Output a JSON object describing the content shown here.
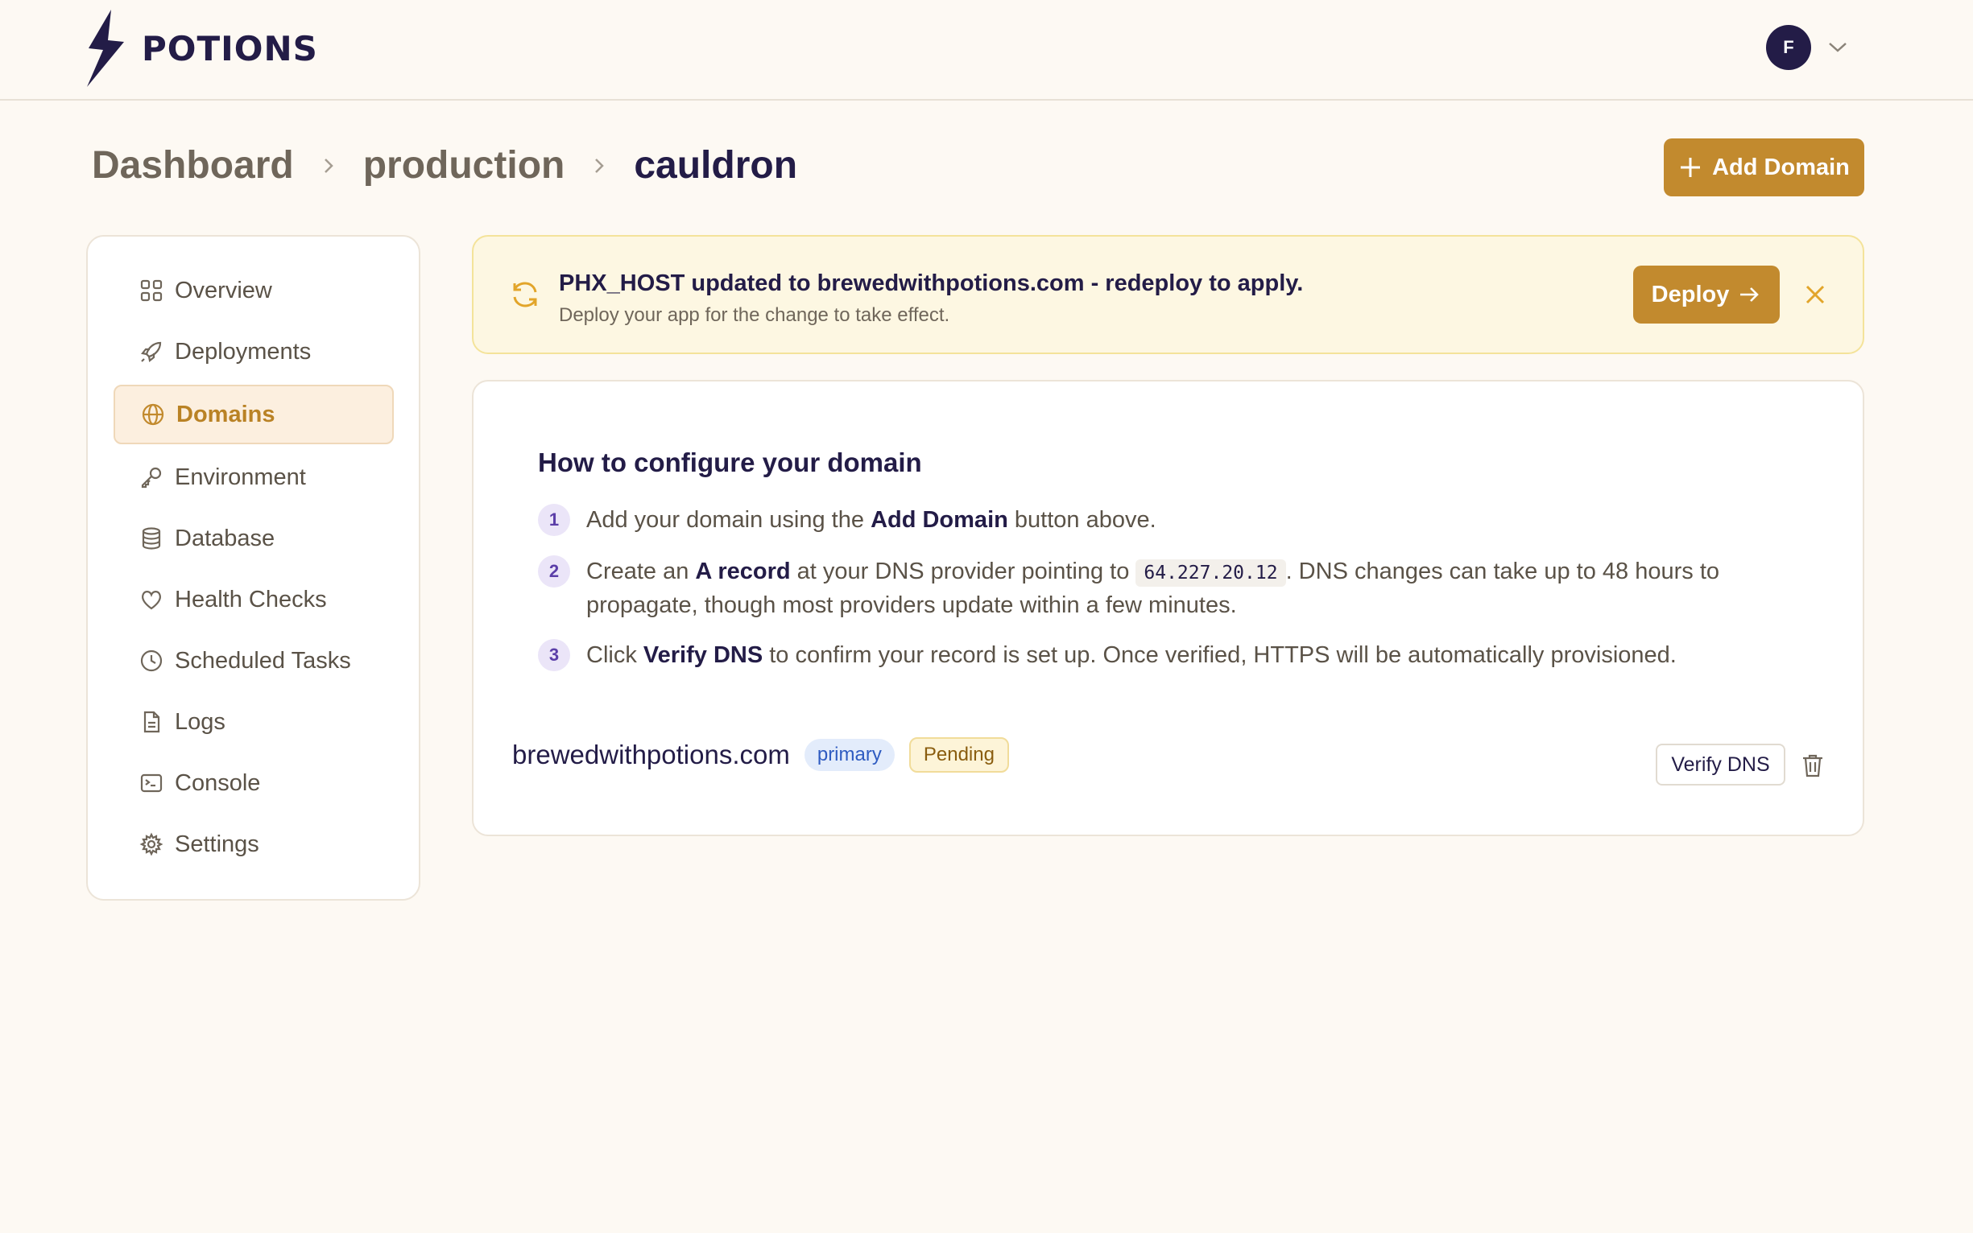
{
  "brand": {
    "name": "POTIONS"
  },
  "user": {
    "initial": "F"
  },
  "breadcrumb": [
    "Dashboard",
    "production",
    "cauldron"
  ],
  "actions": {
    "add_domain_label": "Add Domain"
  },
  "sidebar": {
    "items": [
      {
        "label": "Overview",
        "icon": "grid-icon"
      },
      {
        "label": "Deployments",
        "icon": "rocket-icon"
      },
      {
        "label": "Domains",
        "icon": "globe-icon",
        "active": true
      },
      {
        "label": "Environment",
        "icon": "key-icon"
      },
      {
        "label": "Database",
        "icon": "database-icon"
      },
      {
        "label": "Health Checks",
        "icon": "heart-icon"
      },
      {
        "label": "Scheduled Tasks",
        "icon": "clock-icon"
      },
      {
        "label": "Logs",
        "icon": "document-icon"
      },
      {
        "label": "Console",
        "icon": "terminal-icon"
      },
      {
        "label": "Settings",
        "icon": "gear-icon"
      }
    ]
  },
  "banner": {
    "title": "PHX_HOST updated to brewedwithpotions.com - redeploy to apply.",
    "subtitle": "Deploy your app for the change to take effect.",
    "deploy_label": "Deploy"
  },
  "guide": {
    "title": "How to configure your domain",
    "steps": [
      {
        "number": "1",
        "pre": "Add your domain using the ",
        "bold": "Add Domain",
        "post": " button above."
      },
      {
        "number": "2",
        "pre": "Create an ",
        "bold": "A record",
        "mid": " at your DNS provider pointing to ",
        "code": "64.227.20.12",
        "post": ". DNS changes can take up to 48 hours to propagate, though most providers update within a few minutes."
      },
      {
        "number": "3",
        "pre": "Click ",
        "bold": "Verify DNS",
        "post": " to confirm your record is set up. Once verified, HTTPS will be automatically provisioned."
      }
    ]
  },
  "domain": {
    "name": "brewedwithpotions.com",
    "badge_primary": "primary",
    "badge_status": "Pending",
    "verify_label": "Verify DNS"
  },
  "colors": {
    "accent": "#c28a2e",
    "brand": "#231c47",
    "background": "#fdf9f3"
  }
}
